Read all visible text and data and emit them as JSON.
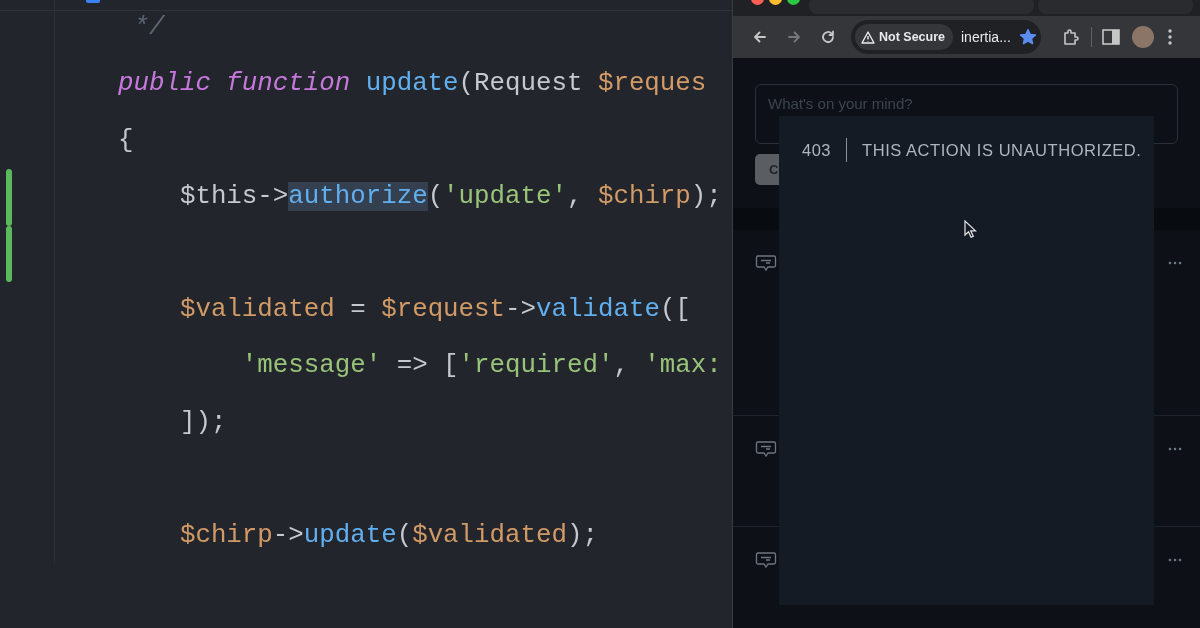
{
  "editor": {
    "lines": [
      {
        "kind": "code",
        "changed": false,
        "tokens": [
          {
            "kind": "comment",
            "text": " */",
            "highlighted": false
          }
        ]
      },
      {
        "kind": "code",
        "changed": false,
        "tokens": [
          {
            "kind": "keyword",
            "text": "public function",
            "highlighted": false
          },
          {
            "kind": "function",
            "text": " update",
            "highlighted": false
          },
          {
            "kind": "plain",
            "text": "(Request ",
            "highlighted": false
          },
          {
            "kind": "variable",
            "text": "$reques",
            "highlighted": false
          }
        ]
      },
      {
        "kind": "code",
        "changed": false,
        "tokens": [
          {
            "kind": "plain",
            "text": "{",
            "highlighted": false
          }
        ]
      },
      {
        "kind": "code",
        "changed": true,
        "tokens": [
          {
            "kind": "plain",
            "text": "    $this->",
            "highlighted": false
          },
          {
            "kind": "function",
            "text": "authorize",
            "highlighted": true
          },
          {
            "kind": "plain",
            "text": "(",
            "highlighted": false
          },
          {
            "kind": "string",
            "text": "'update'",
            "highlighted": false
          },
          {
            "kind": "plain",
            "text": ", ",
            "highlighted": false
          },
          {
            "kind": "variable",
            "text": "$chirp",
            "highlighted": false
          },
          {
            "kind": "plain",
            "text": ");",
            "highlighted": false
          }
        ]
      },
      {
        "kind": "blank",
        "changed": true
      },
      {
        "kind": "code",
        "changed": false,
        "tokens": [
          {
            "kind": "variable",
            "text": "    $validated",
            "highlighted": false
          },
          {
            "kind": "plain",
            "text": " = ",
            "highlighted": false
          },
          {
            "kind": "variable",
            "text": "$request",
            "highlighted": false
          },
          {
            "kind": "plain",
            "text": "->",
            "highlighted": false
          },
          {
            "kind": "function",
            "text": "validate",
            "highlighted": false
          },
          {
            "kind": "plain",
            "text": "([",
            "highlighted": false
          }
        ]
      },
      {
        "kind": "code",
        "changed": false,
        "tokens": [
          {
            "kind": "string",
            "text": "        'message'",
            "highlighted": false
          },
          {
            "kind": "plain",
            "text": " => [",
            "highlighted": false
          },
          {
            "kind": "string",
            "text": "'required'",
            "highlighted": false
          },
          {
            "kind": "plain",
            "text": ", ",
            "highlighted": false
          },
          {
            "kind": "string",
            "text": "'max:",
            "highlighted": false
          }
        ]
      },
      {
        "kind": "code",
        "changed": false,
        "tokens": [
          {
            "kind": "plain",
            "text": "    ]);",
            "highlighted": false
          }
        ]
      },
      {
        "kind": "blank",
        "changed": false
      },
      {
        "kind": "code",
        "changed": false,
        "tokens": [
          {
            "kind": "variable",
            "text": "    $chirp",
            "highlighted": false
          },
          {
            "kind": "plain",
            "text": "->",
            "highlighted": false
          },
          {
            "kind": "function",
            "text": "update",
            "highlighted": false
          },
          {
            "kind": "plain",
            "text": "(",
            "highlighted": false
          },
          {
            "kind": "variable",
            "text": "$validated",
            "highlighted": false
          },
          {
            "kind": "plain",
            "text": ");",
            "highlighted": false
          }
        ]
      }
    ]
  },
  "browser": {
    "nav_buttons": [
      {
        "kind": "back",
        "disabled": false
      },
      {
        "kind": "forward",
        "disabled": true
      },
      {
        "kind": "reload",
        "disabled": false
      }
    ],
    "address_bar": {
      "security_label": "Not Secure",
      "url": "inertia...",
      "bookmarked": true
    },
    "page": {
      "composer": {
        "placeholder": "What's on your mind?",
        "button": "C"
      }
    },
    "error_overlay": {
      "code": "403",
      "message": "THIS ACTION IS UNAUTHORIZED."
    }
  }
}
